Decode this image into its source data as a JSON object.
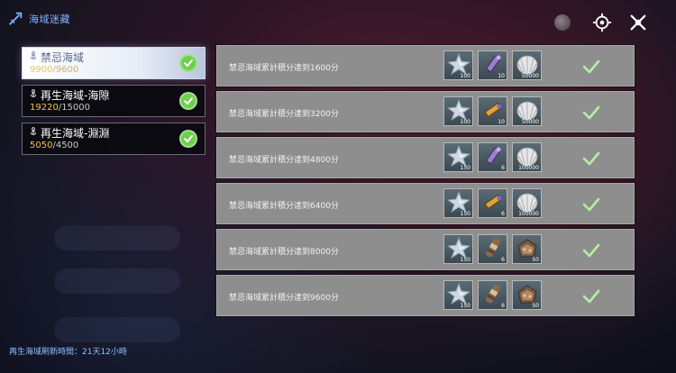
{
  "header": {
    "title": "海域迷藏"
  },
  "zones": [
    {
      "name": "禁忌海域",
      "current": "9900",
      "goal": "9600",
      "completed": true,
      "active": true
    },
    {
      "name": "再生海域-海隙",
      "current": "19220",
      "goal": "15000",
      "completed": true,
      "active": false
    },
    {
      "name": "再生海域-淵淵",
      "current": "5050",
      "goal": "4500",
      "completed": true,
      "active": false
    }
  ],
  "refresh_text": "再生海域刷新時間：21天12小時",
  "rewards": [
    {
      "text": "禁忌海域累計積分達到1600分",
      "items": [
        {
          "icon": "star-shard-icon",
          "qty": "100"
        },
        {
          "icon": "purple-scroll-icon",
          "qty": "10"
        },
        {
          "icon": "shell-icon",
          "qty": "50000"
        }
      ],
      "claimed": true
    },
    {
      "text": "禁忌海域累計積分達到3200分",
      "items": [
        {
          "icon": "star-shard-icon",
          "qty": "100"
        },
        {
          "icon": "gold-scroll-icon",
          "qty": "10"
        },
        {
          "icon": "shell-icon",
          "qty": "50000"
        }
      ],
      "claimed": true
    },
    {
      "text": "禁忌海域累計積分達到4800分",
      "items": [
        {
          "icon": "star-shard-icon",
          "qty": "150"
        },
        {
          "icon": "purple-scroll-icon",
          "qty": "6"
        },
        {
          "icon": "shell-icon",
          "qty": "100000"
        }
      ],
      "claimed": true
    },
    {
      "text": "禁忌海域累計積分達到6400分",
      "items": [
        {
          "icon": "star-shard-icon",
          "qty": "150"
        },
        {
          "icon": "gold-scroll-icon",
          "qty": "6"
        },
        {
          "icon": "shell-icon",
          "qty": "100000"
        }
      ],
      "claimed": true
    },
    {
      "text": "禁忌海域累計積分達到8000分",
      "items": [
        {
          "icon": "star-shard-icon",
          "qty": "150"
        },
        {
          "icon": "canister-icon",
          "qty": "6"
        },
        {
          "icon": "ore-chest-icon",
          "qty": "50"
        }
      ],
      "claimed": true
    },
    {
      "text": "禁忌海域累計積分達到9600分",
      "items": [
        {
          "icon": "star-shard-icon",
          "qty": "150"
        },
        {
          "icon": "canister-icon",
          "qty": "6"
        },
        {
          "icon": "ore-chest-icon",
          "qty": "50"
        }
      ],
      "claimed": true
    }
  ],
  "colors": {
    "accent_blue": "#7fb6ff",
    "score_gold": "#f0c24a",
    "check_green": "#6fcf4f",
    "row_bg": "#8e8e8e"
  }
}
